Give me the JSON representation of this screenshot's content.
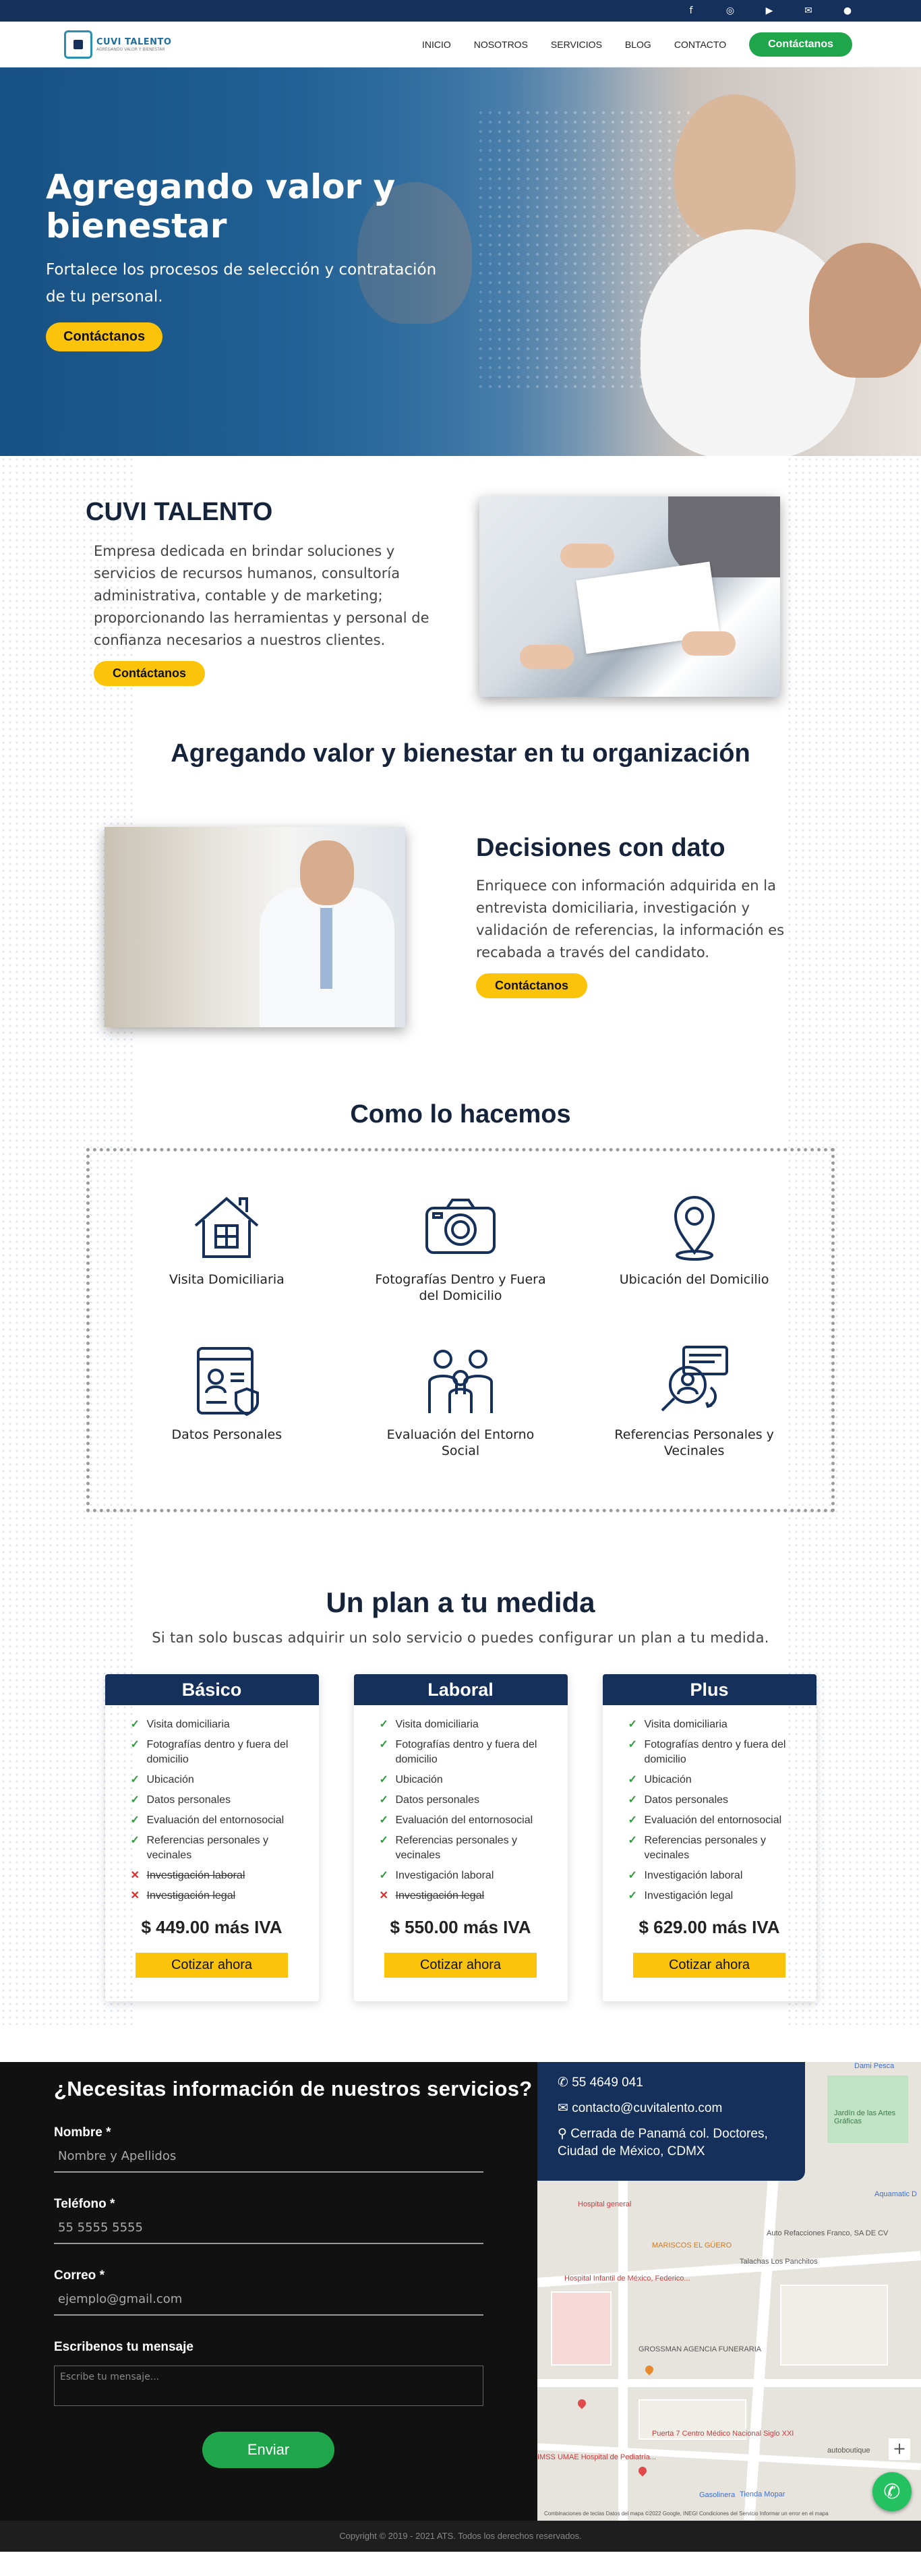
{
  "topbar": {
    "icons": [
      "facebook-icon",
      "instagram-icon",
      "youtube-icon",
      "email-icon",
      "user-icon"
    ]
  },
  "header": {
    "logo_text": "CUVI TALENTO",
    "logo_sub": "AGREGANDO VALOR Y BIENESTAR",
    "nav": [
      "INICIO",
      "NOSOTROS",
      "SERVICIOS",
      "BLOG",
      "CONTACTO"
    ],
    "cta": "Contáctanos"
  },
  "hero": {
    "title": "Agregando valor y bienestar",
    "subtitle": "Fortalece los procesos de selección y contratación de tu personal.",
    "cta": "Contáctanos"
  },
  "about": {
    "title": "CUVI TALENTO",
    "text": "Empresa dedicada en brindar soluciones y servicios de recursos humanos, consultoría administrativa, contable y de marketing; proporcionando las herramientas y personal de confianza necesarios a nuestros clientes.",
    "cta": "Contáctanos"
  },
  "tagline": "Agregando valor y bienestar en tu organización",
  "decisions": {
    "title": "Decisiones con dato",
    "text": "Enriquece con información adquirida en la entrevista domiciliaria, investigación y validación de referencias, la información es recabada a través del candidato.",
    "cta": "Contáctanos"
  },
  "how": {
    "title": "Como lo hacemos",
    "items": [
      {
        "label": "Visita Domiciliaria",
        "icon": "house-icon"
      },
      {
        "label": "Fotografías Dentro y Fuera del Domicilio",
        "icon": "camera-icon"
      },
      {
        "label": "Ubicación del Domicilio",
        "icon": "location-pin-icon"
      },
      {
        "label": "Datos Personales",
        "icon": "personal-data-icon"
      },
      {
        "label": "Evaluación del Entorno Social",
        "icon": "family-icon"
      },
      {
        "label": "Referencias Personales y Vecinales",
        "icon": "search-person-icon"
      }
    ]
  },
  "plans": {
    "title": "Un plan a tu medida",
    "subtitle": "Si tan solo buscas adquirir un solo servicio o puedes configurar un plan a tu medida.",
    "cards": [
      {
        "name": "Básico",
        "features": [
          {
            "text": "Visita domiciliaria",
            "included": true
          },
          {
            "text": "Fotografías dentro y fuera del domicilio",
            "included": true
          },
          {
            "text": "Ubicación",
            "included": true
          },
          {
            "text": "Datos personales",
            "included": true
          },
          {
            "text": "Evaluación del entornosocial",
            "included": true
          },
          {
            "text": "Referencias personales y vecinales",
            "included": true
          },
          {
            "text": "Investigación laboral",
            "included": false
          },
          {
            "text": "Investigación legal",
            "included": false
          }
        ],
        "price": "$ 449.00 más IVA",
        "cta": "Cotizar ahora"
      },
      {
        "name": "Laboral",
        "features": [
          {
            "text": "Visita domiciliaria",
            "included": true
          },
          {
            "text": "Fotografías dentro y fuera del domicilio",
            "included": true
          },
          {
            "text": "Ubicación",
            "included": true
          },
          {
            "text": "Datos personales",
            "included": true
          },
          {
            "text": "Evaluación del entornosocial",
            "included": true
          },
          {
            "text": "Referencias personales y vecinales",
            "included": true
          },
          {
            "text": "Investigación laboral",
            "included": true
          },
          {
            "text": "Investigación legal",
            "included": false
          }
        ],
        "price": "$ 550.00 más IVA",
        "cta": "Cotizar ahora"
      },
      {
        "name": "Plus",
        "features": [
          {
            "text": "Visita domiciliaria",
            "included": true
          },
          {
            "text": "Fotografías dentro y fuera del domicilio",
            "included": true
          },
          {
            "text": "Ubicación",
            "included": true
          },
          {
            "text": "Datos personales",
            "included": true
          },
          {
            "text": "Evaluación del entornosocial",
            "included": true
          },
          {
            "text": "Referencias personales y vecinales",
            "included": true
          },
          {
            "text": "Investigación laboral",
            "included": true
          },
          {
            "text": "Investigación legal",
            "included": true
          }
        ],
        "price": "$ 629.00 más IVA",
        "cta": "Cotizar ahora"
      }
    ]
  },
  "contact": {
    "title": "¿Necesitas información de nuestros servicios?",
    "name_label": "Nombre *",
    "name_placeholder": "Nombre y Apellidos",
    "phone_label": "Teléfono *",
    "phone_placeholder": "55 5555 5555",
    "email_label": "Correo *",
    "email_placeholder": "ejemplo@gmail.com",
    "message_label": "Escribenos tu mensaje",
    "message_placeholder": "Escribe tu mensaje...",
    "send": "Enviar"
  },
  "info": {
    "phone": "55 4649 041",
    "email": "contacto@cuvitalento.com",
    "address": "Cerrada de Panamá col. Doctores, Ciudad de México, CDMX"
  },
  "map": {
    "labels": [
      "Jardín de las Artes Gráficas",
      "Hospital general",
      "Auto Refacciones Franco, SA DE CV",
      "MARISCOS EL GÜERO",
      "Hospital Infantil de México, Federico...",
      "GROSSMAN AGENCIA FUNERARIA",
      "Puerta 7 Centro Médico Nacional Siglo XXI",
      "IMSS UMAE Hospital de Pediatría...",
      "Tienda Mopar",
      "autoboutique",
      "Gasolinera",
      "Aquamatic D",
      "Dami Pesca",
      "Talachas Los Panchitos"
    ],
    "credits": "Combinaciones de teclas   Datos del mapa ©2022 Google, INEGI   Condiciones del Servicio   Informar un error en el mapa"
  },
  "footer": "Copyright © 2019 - 2021 ATS. Todos los derechos reservados."
}
